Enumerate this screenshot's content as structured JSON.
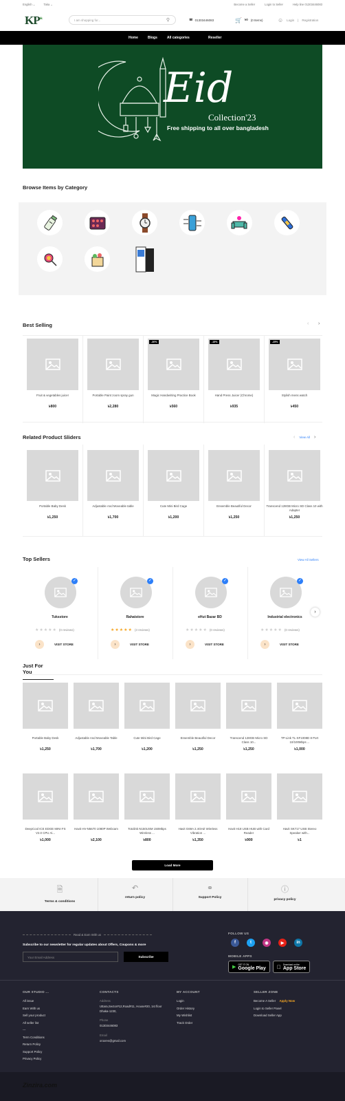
{
  "topbar": {
    "language": "English ⌄",
    "currency": "Taka ⌄",
    "links": [
      "Become a Seller",
      "Login to Seller",
      "Help line 01303446083"
    ]
  },
  "header": {
    "logo": "KP",
    "logo_sub": "ok",
    "search_placeholder": "I am shopping for...",
    "phone": "01303446083",
    "cart_amount": "৳0",
    "cart_items": "(0 Items)",
    "login": "Login",
    "register": "Registration"
  },
  "nav": [
    "Home",
    "Blogs",
    "All categories",
    "Reseller"
  ],
  "banner": {
    "title": "Eid",
    "subtitle": "Collection'23",
    "tagline": "Free shipping to all over bangladesh"
  },
  "categories": {
    "title": "Browse Items by Category",
    "items": [
      "baby-bottle-icon",
      "palette-icon",
      "watch-icon",
      "phone-icon",
      "sofa-icon",
      "tools-icon",
      "lollipop-icon",
      "grocery-icon",
      "books-icon"
    ]
  },
  "best_selling": {
    "title": "Best Selling",
    "products": [
      {
        "name": "Fruit & vegetables juicer",
        "price": "৳800",
        "badge": ""
      },
      {
        "name": "Portable Paint zoom spray gun",
        "price": "৳2,280",
        "badge": ""
      },
      {
        "name": "Magic Handwriting Practice Book",
        "price": "৳560",
        "badge": "-30%"
      },
      {
        "name": "Hand Press Juicer (Chrome)",
        "price": "৳935",
        "badge": "-15%"
      },
      {
        "name": "Stylish mens watch",
        "price": "৳450",
        "badge": "-25%"
      }
    ]
  },
  "related": {
    "title": "Related Product Sliders",
    "view_all": "View All",
    "products": [
      {
        "name": "Portable Baby Desk",
        "price": "৳1,250"
      },
      {
        "name": "Adjustable And Moveable table",
        "price": "৳1,700"
      },
      {
        "name": "Cute Mini Bird Cage",
        "price": "৳1,200"
      },
      {
        "name": "Ensemble Beautiful Decor",
        "price": "৳1,250"
      },
      {
        "name": "Transcend 128GB Micro SD Class 10 with Adapter",
        "price": "৳1,250"
      }
    ]
  },
  "top_sellers": {
    "title": "Top Sellers",
    "view_all": "View All Sellers",
    "visit_label": "VISIT STORE",
    "sellers": [
      {
        "name": "Tuksstore",
        "reviews": "(0 reviews)",
        "rating": 0
      },
      {
        "name": "Rahatstore",
        "reviews": "(3 reviews)",
        "rating": 5
      },
      {
        "name": "eHut Bazar BD",
        "reviews": "(0 reviews)",
        "rating": 0
      },
      {
        "name": "Industrial electronics",
        "reviews": "(0 reviews)",
        "rating": 0
      }
    ]
  },
  "just_for_you": {
    "title": "Just For You",
    "load_more": "Load More",
    "products": [
      {
        "name": "Portable Baby Desk",
        "price": "৳1,250"
      },
      {
        "name": "Adjustable And Moveable Table",
        "price": "৳1,700"
      },
      {
        "name": "Cute Mini Bird Cage",
        "price": "৳1,200"
      },
      {
        "name": "Ensemble Beautiful Decor",
        "price": "৳1,250"
      },
      {
        "name": "Transcend 128GB Micro SD Class 10...",
        "price": "৳1,250"
      },
      {
        "name": "TP-Link TL-SF1008D 8 Port 10/100Mbps ...",
        "price": "৳1,000"
      },
      {
        "name": "DeepCool ICE EDGE MINI FS V2.0 CPU Ai...",
        "price": "৳1,000"
      },
      {
        "name": "Havit HV-N5670 1080P Webcam",
        "price": "৳2,100"
      },
      {
        "name": "Totolink N150USM 150Mbps Wireless ...",
        "price": "৳800"
      },
      {
        "name": "Havit G69A 2.4GHZ Wireless Vibration ...",
        "price": "৳1,350"
      },
      {
        "name": "Havit H18 USB HUB with Card Reader",
        "price": "৳900"
      },
      {
        "name": "Havit SK717 USB Stereo Speaker with...",
        "price": "৳1"
      }
    ]
  },
  "policies": [
    "Terms & conditions",
    "return policy",
    "Support Policy",
    "privacy policy"
  ],
  "footer": {
    "earn_heading": "Read & Earn With us",
    "newsletter": "Subscribe to our newsletter for regular updates about Offers, Coupons & more",
    "email_placeholder": "Your Email Address",
    "subscribe": "Subscribe",
    "follow_us": "FOLLOW US",
    "mobile_apps": "MOBILE APPS",
    "google_top": "GET IT ON",
    "google": "Google Play",
    "apple_top": "Download on the",
    "apple": "App Store",
    "studio_heading": "OUR STUDIO ...",
    "studio_links": [
      "All issue",
      "Earn With us",
      "Sell your product",
      "All seller list",
      "---",
      "Term Conditions",
      "Return Policy",
      "Support Policy",
      "Privacy Policy"
    ],
    "contacts_heading": "CONTACTS",
    "address_label": "Address",
    "address": "Uttara,Sector#12,Road#11, House#20, 1st floor Dhaka-1230,",
    "phone_label": "Phone",
    "phone": "01303446083",
    "email_label": "Email",
    "email": "xroxres@gmail.com",
    "account_heading": "MY ACCOUNT",
    "account_links": [
      "Login",
      "Order History",
      "My Wishlist",
      "Track Order"
    ],
    "seller_heading": "SELLER ZONE",
    "become_seller": "Become A Seller",
    "apply_now": "Apply Now",
    "seller_links": [
      "Login to Seller Panel",
      "Download Seller App"
    ],
    "brand": "Zinzira.com",
    "colors": {
      "footer_bg": "#232330",
      "accent": "#f5a623",
      "link_blue": "#2d7ff9"
    }
  }
}
